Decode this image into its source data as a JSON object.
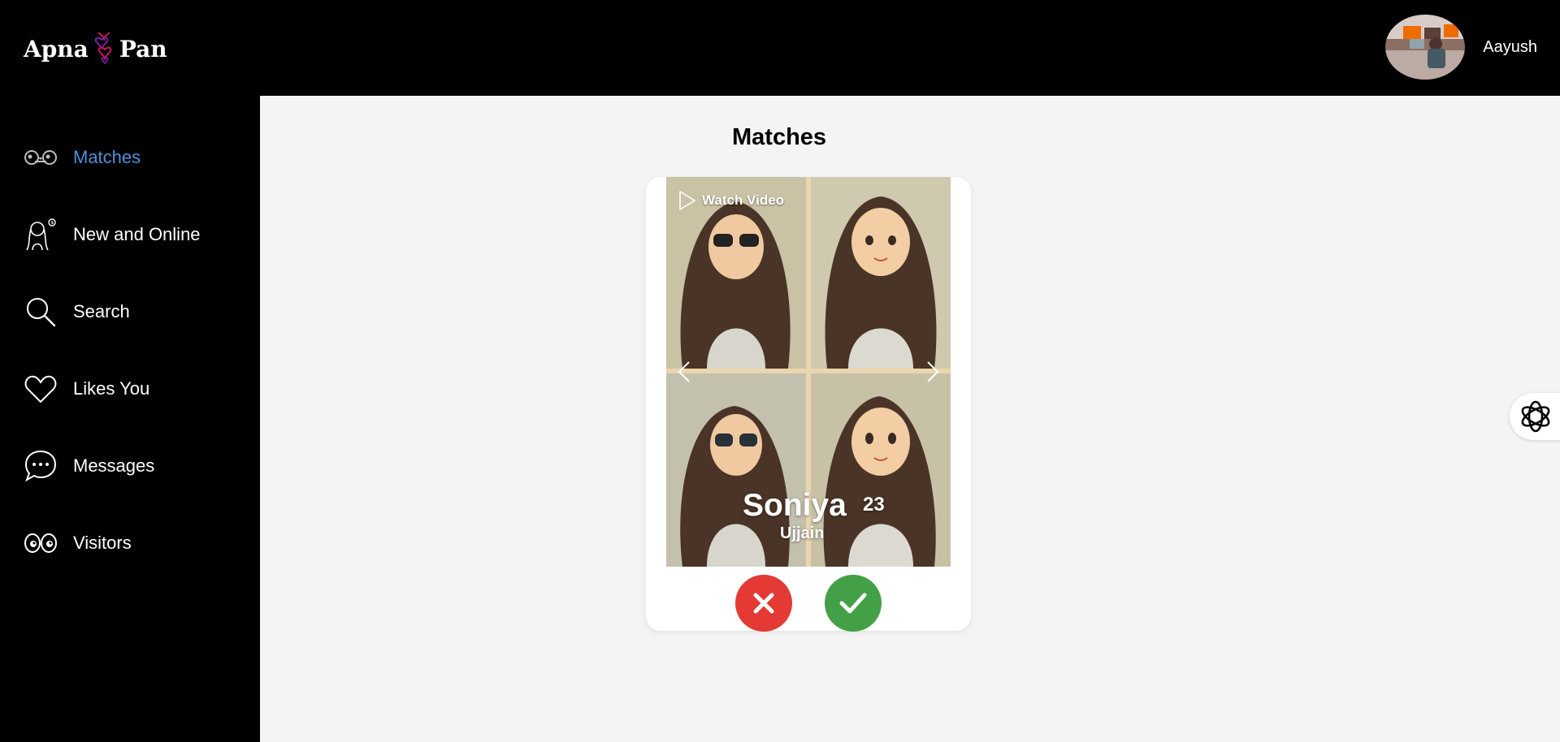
{
  "brand": {
    "left": "Apna",
    "right": "Pan"
  },
  "user": {
    "name": "Aayush"
  },
  "sidebar": {
    "items": [
      {
        "label": "Matches",
        "icon": "matches-icon",
        "active": true
      },
      {
        "label": "New and Online",
        "icon": "new-online-icon"
      },
      {
        "label": "Search",
        "icon": "search-icon"
      },
      {
        "label": "Likes You",
        "icon": "heart-icon"
      },
      {
        "label": "Messages",
        "icon": "chat-icon"
      },
      {
        "label": "Visitors",
        "icon": "eyes-icon"
      }
    ]
  },
  "main": {
    "title": "Matches"
  },
  "profile": {
    "watch_video": "Watch Video",
    "name": "Soniya",
    "age": "23",
    "city": "Ujjain"
  },
  "colors": {
    "active": "#4f8fd8",
    "reject": "#e53935",
    "accept": "#43a047"
  }
}
